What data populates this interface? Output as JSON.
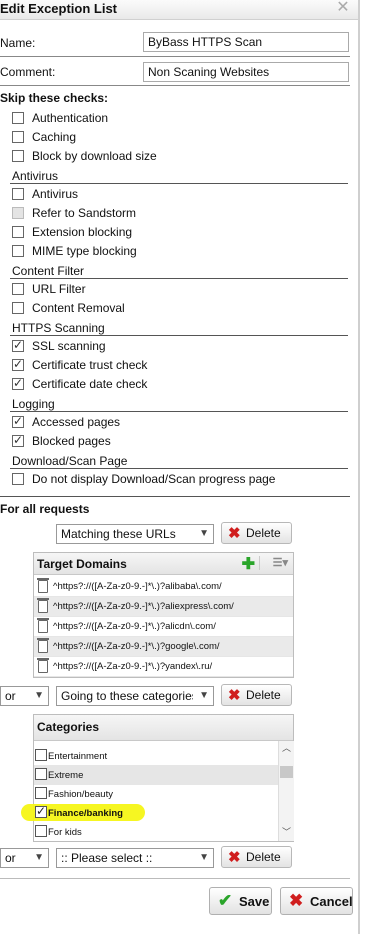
{
  "window": {
    "title": "Edit Exception List",
    "close_glyph": "✕"
  },
  "form": {
    "name_label": "Name:",
    "name_value": "ByBass HTTPS Scan",
    "comment_label": "Comment:",
    "comment_value": "Non Scaning Websites"
  },
  "skip_heading": "Skip these checks:",
  "checks_general": [
    {
      "label": "Authentication",
      "checked": false
    },
    {
      "label": "Caching",
      "checked": false
    },
    {
      "label": "Block by download size",
      "checked": false
    }
  ],
  "antivirus": {
    "heading": "Antivirus",
    "items": [
      {
        "label": "Antivirus",
        "checked": false
      },
      {
        "label": "Refer to Sandstorm",
        "checked": false,
        "disabled": true
      },
      {
        "label": "Extension blocking",
        "checked": false
      },
      {
        "label": "MIME type blocking",
        "checked": false
      }
    ]
  },
  "content_filter": {
    "heading": "Content Filter",
    "items": [
      {
        "label": "URL Filter",
        "checked": false
      },
      {
        "label": "Content Removal",
        "checked": false
      }
    ]
  },
  "https_scanning": {
    "heading": "HTTPS Scanning",
    "items": [
      {
        "label": "SSL scanning",
        "checked": true
      },
      {
        "label": "Certificate trust check",
        "checked": true
      },
      {
        "label": "Certificate date check",
        "checked": true
      }
    ]
  },
  "logging": {
    "heading": "Logging",
    "items": [
      {
        "label": "Accessed pages",
        "checked": true
      },
      {
        "label": "Blocked pages",
        "checked": true
      }
    ]
  },
  "download_scan": {
    "heading": "Download/Scan Page",
    "items": [
      {
        "label": "Do not display Download/Scan progress page",
        "checked": false
      }
    ]
  },
  "requests": {
    "heading": "For all requests",
    "condition1": "Matching these URLs",
    "delete_label": "Delete",
    "domains_panel": {
      "title": "Target Domains",
      "add_glyph": "✚",
      "menu_glyph": "☰▾",
      "rows": [
        "^https?://([A-Za-z0-9.-]*\\.)?alibaba\\.com/",
        "^https?://([A-Za-z0-9.-]*\\.)?aliexpress\\.com/",
        "^https?://([A-Za-z0-9.-]*\\.)?alicdn\\.com/",
        "^https?://([A-Za-z0-9.-]*\\.)?google\\.com/",
        "^https?://([A-Za-z0-9.-]*\\.)?yandex\\.ru/"
      ]
    },
    "join2": "or",
    "condition2": "Going to these categories",
    "categories_panel": {
      "title": "Categories",
      "rows": [
        {
          "label": "Entertainment",
          "checked": false
        },
        {
          "label": "Extreme",
          "checked": false
        },
        {
          "label": "Fashion/beauty",
          "checked": false
        },
        {
          "label": "Finance/banking",
          "checked": true
        },
        {
          "label": "For kids",
          "checked": false
        }
      ]
    },
    "join3": "or",
    "condition3": ":: Please select ::"
  },
  "actions": {
    "save": "Save",
    "cancel": "Cancel"
  },
  "colors": {
    "highlight": "#f5f516",
    "delete_red": "#d01e1e",
    "save_green": "#2aa52a"
  }
}
